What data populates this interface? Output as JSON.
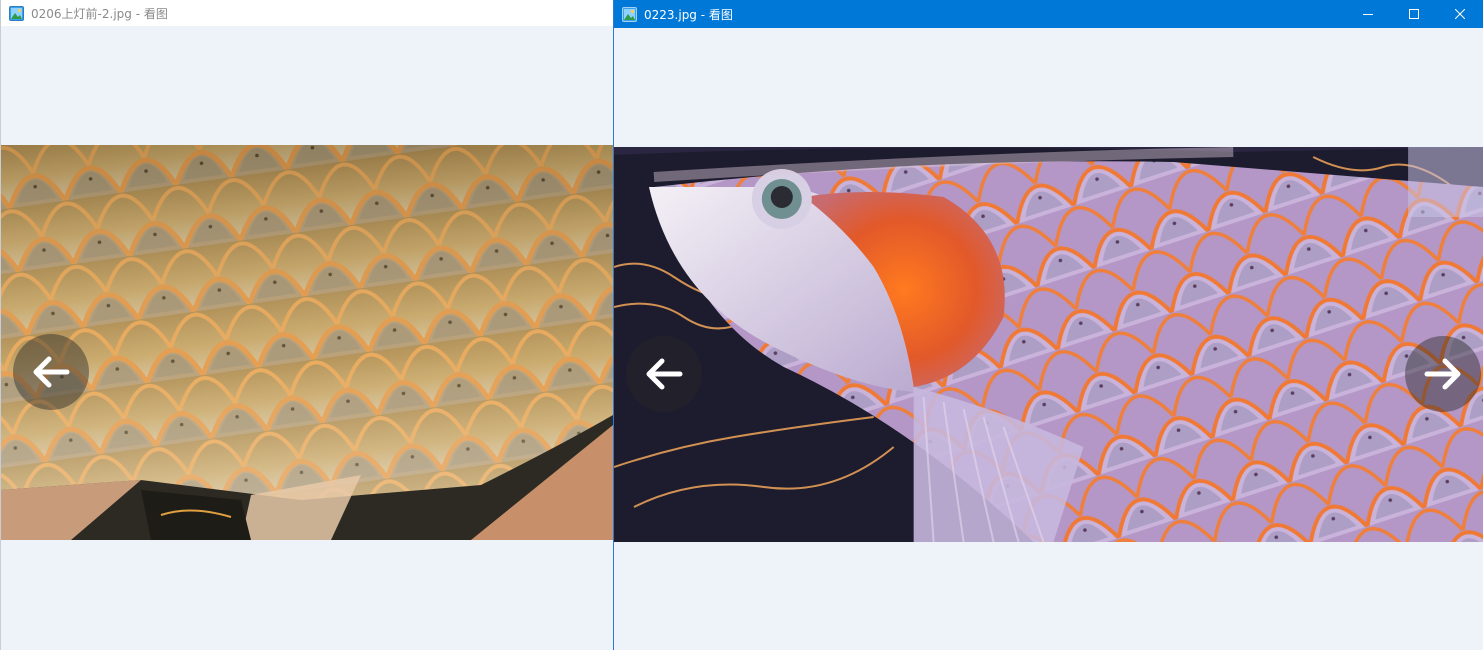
{
  "left_window": {
    "title": "0206上灯前-2.jpg - 看图",
    "icons": {
      "app": "image-app-icon",
      "prev": "arrow-left-icon"
    }
  },
  "right_window": {
    "title": "0223.jpg - 看图",
    "icons": {
      "app": "image-app-icon",
      "minimize": "minimize-icon",
      "maximize": "maximize-icon",
      "close": "close-icon",
      "prev": "arrow-left-icon",
      "next": "arrow-right-icon"
    }
  },
  "colors": {
    "titlebar_active": "#0078d7",
    "titlebar_inactive": "#ffffff",
    "viewer_background": "#eef2f9",
    "left_photo_scales": "#c99e5c",
    "right_photo_scales": "#c3a3d0",
    "right_photo_orange": "#f36c22",
    "right_photo_background": "#1d1b2e"
  }
}
